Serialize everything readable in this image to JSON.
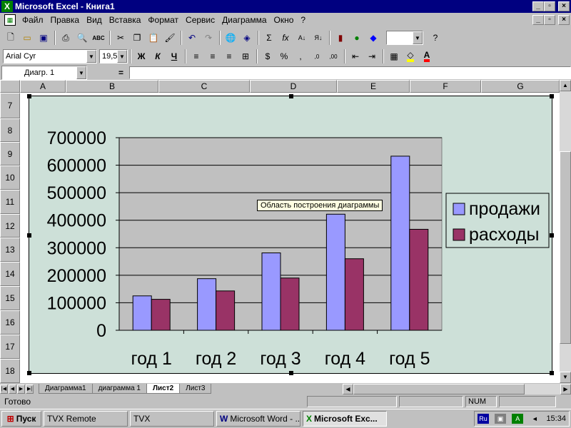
{
  "window": {
    "title": "Microsoft Excel - Книга1",
    "app_icon": "excel-icon",
    "caption_buttons": [
      "_",
      "▫",
      "×"
    ]
  },
  "menu": {
    "items": [
      "Файл",
      "Правка",
      "Вид",
      "Вставка",
      "Формат",
      "Сервис",
      "Диаграмма",
      "Окно",
      "?"
    ],
    "doc_buttons": [
      "_",
      "▫",
      "×"
    ]
  },
  "standard_toolbar": {
    "icons": [
      "new-icon",
      "open-icon",
      "save-icon",
      "print-icon",
      "print-preview-icon",
      "spelling-icon",
      "cut-icon",
      "copy-icon",
      "paste-icon",
      "format-painter-icon",
      "undo-icon",
      "redo-icon",
      "hyperlink-icon",
      "web-toolbar-icon",
      "autosum-icon",
      "function-icon",
      "sort-ascending-icon",
      "sort-descending-icon",
      "chart-wizard-icon",
      "map-icon",
      "drawing-icon",
      "help-icon"
    ],
    "zoom_value": ""
  },
  "format_toolbar": {
    "font": "Arial Cyr",
    "size": "19,5",
    "bold": "Ж",
    "italic": "К",
    "underline": "Ч",
    "percent": "%",
    "comma": ",",
    "fill_color": "#ffff00",
    "font_color": "#ff0000"
  },
  "formula_bar": {
    "name_box": "Диагр. 1",
    "equals": "=",
    "content": ""
  },
  "grid": {
    "columns": [
      "A",
      "B",
      "C",
      "D",
      "E",
      "F",
      "G"
    ],
    "rows": [
      "7",
      "8",
      "9",
      "10",
      "11",
      "12",
      "13",
      "14",
      "15",
      "16",
      "17",
      "18"
    ]
  },
  "chart_data": {
    "type": "bar",
    "categories": [
      "год 1",
      "год 2",
      "год 3",
      "год 4",
      "год 5"
    ],
    "series": [
      {
        "name": "продажи",
        "values": [
          125000,
          187500,
          281250,
          421875,
          632813
        ],
        "color": "#9999ff"
      },
      {
        "name": "расходы",
        "values": [
          112500,
          143000,
          190000,
          260000,
          367000
        ],
        "color": "#993366"
      }
    ],
    "ylim": [
      0,
      700000
    ],
    "yticks": [
      0,
      100000,
      200000,
      300000,
      400000,
      500000,
      600000,
      700000
    ],
    "grid": true,
    "legend_position": "right",
    "plot_area_color": "#c0c0c0",
    "chart_area_color": "#cde0d8",
    "tooltip": "Область построения диаграммы"
  },
  "sheets": {
    "tabs": [
      "Диаграмма1",
      "диаграмма 1",
      "Лист2",
      "Лист3"
    ],
    "active": "Лист2"
  },
  "status": {
    "message": "Готово",
    "num_indicator": "NUM"
  },
  "taskbar": {
    "start": "Пуск",
    "buttons": [
      "TVX Remote",
      "TVX",
      "Microsoft Word - ...",
      "Microsoft Exc..."
    ],
    "active": "Microsoft Exc...",
    "clock": "15:34",
    "lang": "Ru"
  }
}
